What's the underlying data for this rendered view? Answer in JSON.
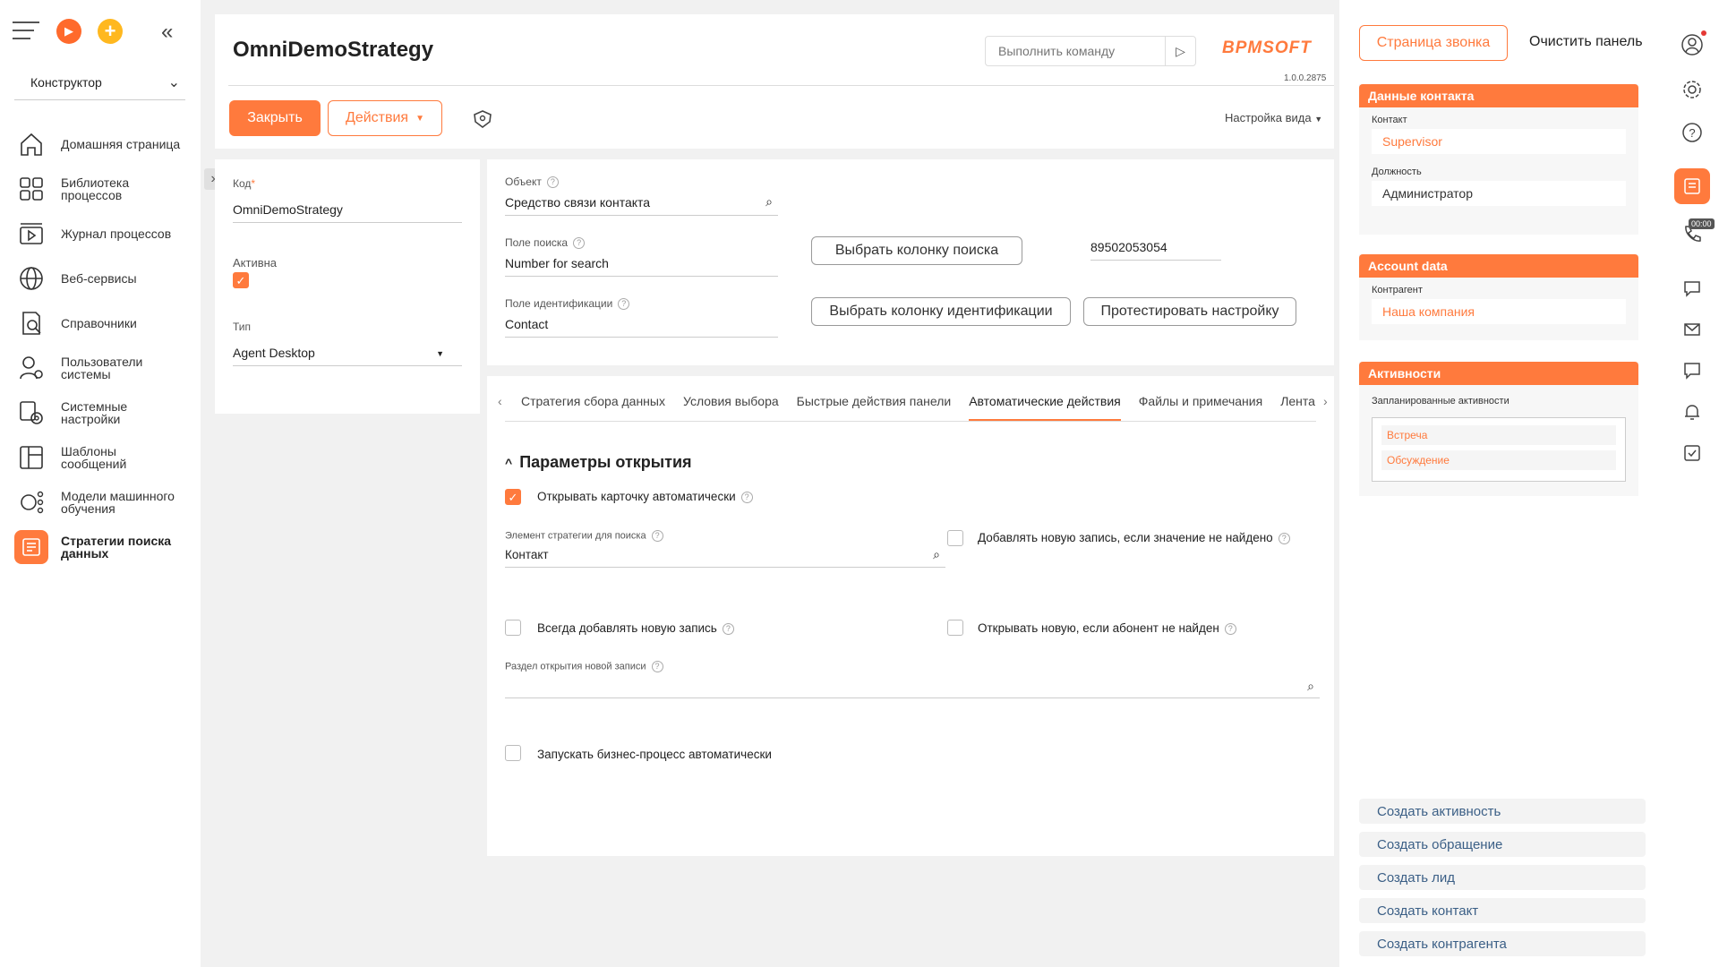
{
  "sidebar": {
    "workspace": "Конструктор",
    "items": [
      {
        "label": "Домашняя страница",
        "icon": "home-icon"
      },
      {
        "label": "Библиотека процессов",
        "icon": "process-library-icon"
      },
      {
        "label": "Журнал процессов",
        "icon": "process-log-icon"
      },
      {
        "label": "Веб-сервисы",
        "icon": "globe-icon"
      },
      {
        "label": "Справочники",
        "icon": "lookup-icon"
      },
      {
        "label": "Пользователи системы",
        "icon": "users-icon"
      },
      {
        "label": "Системные настройки",
        "icon": "settings-icon"
      },
      {
        "label": "Шаблоны сообщений",
        "icon": "template-icon"
      },
      {
        "label": "Модели машинного обучения",
        "icon": "ml-icon"
      },
      {
        "label": "Стратегии поиска данных",
        "icon": "strategy-icon"
      }
    ]
  },
  "header": {
    "title": "OmniDemoStrategy",
    "command_placeholder": "Выполнить команду",
    "brand": "BPMSOFT",
    "version": "1.0.0.2875",
    "close_label": "Закрыть",
    "actions_label": "Действия",
    "view_settings_label": "Настройка вида"
  },
  "left_card": {
    "code_label": "Код",
    "code_value": "OmniDemoStrategy",
    "active_label": "Активна",
    "type_label": "Тип",
    "type_value": "Agent Desktop"
  },
  "settings_card": {
    "object_label": "Объект",
    "object_value": "Средство связи контакта",
    "search_field_label": "Поле поиска",
    "search_field_value": "Number for search",
    "id_field_label": "Поле идентификации",
    "id_field_value": "Contact",
    "choose_search_column": "Выбрать колонку поиска",
    "test_value": "89502053054",
    "choose_id_column": "Выбрать колонку идентификации",
    "test_settings": "Протестировать настройку"
  },
  "tabs": [
    "Стратегия сбора данных",
    "Условия выбора",
    "Быстрые действия панели",
    "Автоматические действия",
    "Файлы и примечания",
    "Лента"
  ],
  "open_params": {
    "section_title": "Параметры открытия",
    "open_card_auto": "Открывать карточку автоматически",
    "strategy_element_label": "Элемент стратегии для поиска",
    "strategy_element_value": "Контакт",
    "add_new_if_not_found": "Добавлять новую запись, если значение не найдено",
    "always_add_new": "Всегда добавлять новую запись",
    "open_new_if_not_found": "Открывать новую, если абонент не найден",
    "new_record_section_label": "Раздел открытия новой записи",
    "run_bp_auto": "Запускать бизнес-процесс автоматически"
  },
  "right_panel": {
    "call_page_btn": "Страница звонка",
    "clear_panel_btn": "Очистить панель",
    "contact_data_title": "Данные контакта",
    "contact_label": "Контакт",
    "contact_value": "Supervisor",
    "position_label": "Должность",
    "position_value": "Администратор",
    "account_title": "Account data",
    "account_label": "Контрагент",
    "account_value": "Наша компания",
    "activities_title": "Активности",
    "planned_label": "Запланированные активности",
    "activities": [
      "Встреча",
      "Обсуждение"
    ],
    "quick_actions": [
      "Создать активность",
      "Создать обращение",
      "Создать лид",
      "Создать контакт",
      "Создать контрагента"
    ],
    "timer": "00:00"
  }
}
